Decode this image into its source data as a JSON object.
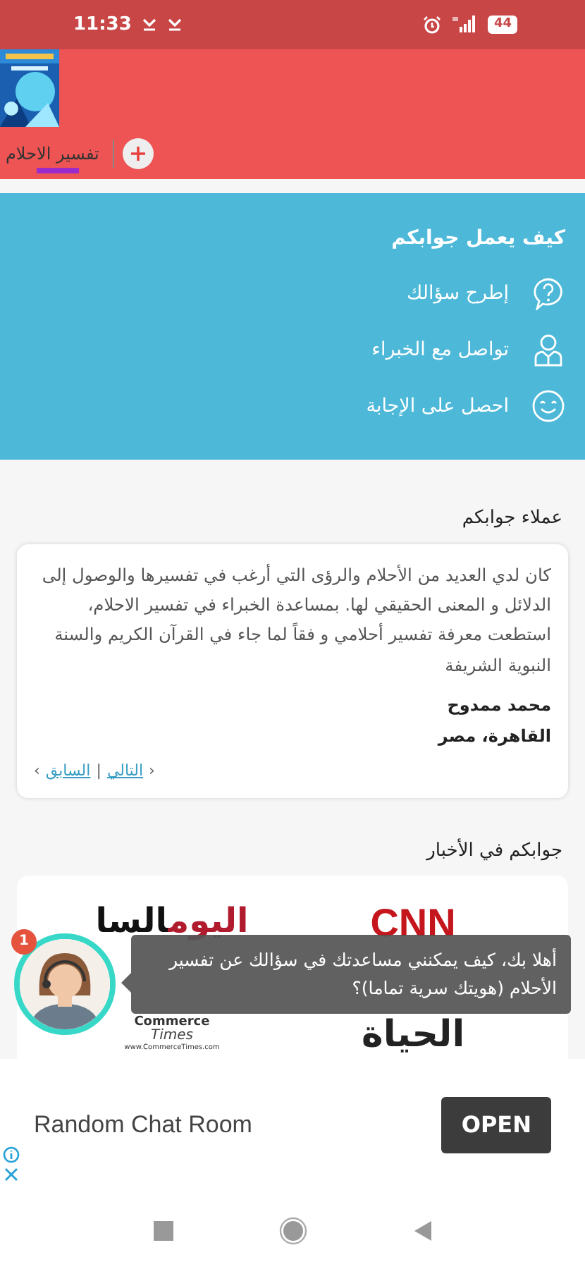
{
  "status_bar": {
    "time": "11:33",
    "battery": "44"
  },
  "app_bar": {
    "tabs": [
      {
        "label": "تفسير الاحلام",
        "selected": true
      }
    ]
  },
  "how_it_works": {
    "title": "كيف يعمل جوابكم",
    "steps": [
      {
        "kind": "question",
        "text": "إطرح سؤالك"
      },
      {
        "kind": "expert",
        "text": "تواصل مع الخبراء"
      },
      {
        "kind": "smile",
        "text": "احصل على الإجابة"
      }
    ]
  },
  "testimonials": {
    "title": "عملاء جوابكم",
    "quote": "كان لدي العديد من الأحلام والرؤى التي أرغب في تفسيرها والوصول إلى الدلائل و المعنى الحقيقي لها. بمساعدة الخبراء في تفسير الاحلام، استطعت معرفة تفسير أحلامي و فقاً لما جاء في القرآن الكريم والسنة النبوية الشريفة",
    "name": "محمد ممدوح",
    "location": "القاهرة، مصر",
    "pager": {
      "left_mark": "‹",
      "prev": "السابق",
      "separator": "|",
      "next": "التالي",
      "right_mark": "›"
    }
  },
  "news": {
    "title": "جوابكم في الأخبار",
    "logos": [
      {
        "kind": "cnn",
        "text": "CNN"
      },
      {
        "kind": "youm7",
        "text": "اليوم",
        "text_2": "السا"
      },
      {
        "kind": "hayat",
        "text": "الحياة"
      },
      {
        "kind": "commerce",
        "text": "Commerce",
        "text_2": "Times",
        "text_3": "www.CommerceTimes.com"
      }
    ]
  },
  "chat": {
    "badge": "1",
    "message": "أهلا بك، كيف يمكنني مساعدتك في سؤالك عن تفسير الأحلام (هويتك سرية تماما)؟"
  },
  "ad": {
    "title": "Random Chat Room",
    "button": "OPEN"
  }
}
